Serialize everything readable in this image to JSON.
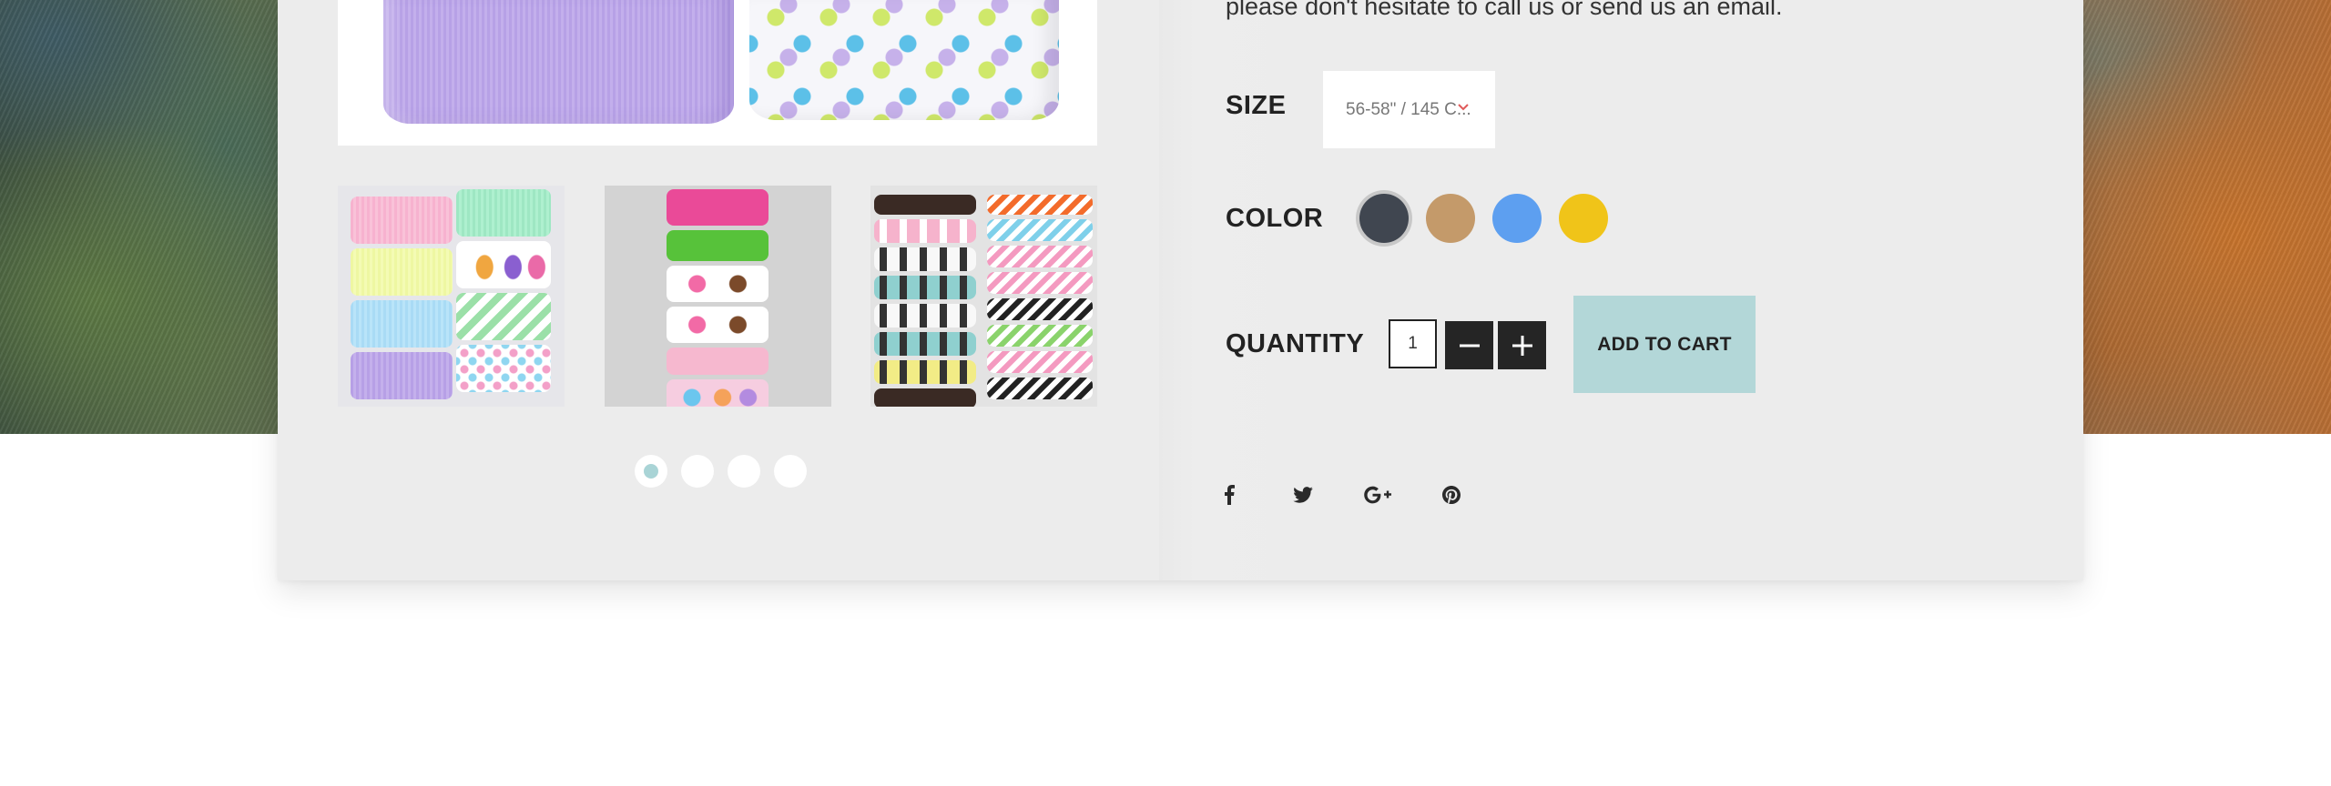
{
  "product": {
    "description_tail": "please don't hesitate to call us or send us an email."
  },
  "size": {
    "label": "SIZE",
    "selected": "56-58\" / 145 C...",
    "chevron_icon": "chevron-down-icon"
  },
  "color": {
    "label": "COLOR",
    "swatches": [
      {
        "name": "charcoal",
        "hex": "#404650",
        "selected": true
      },
      {
        "name": "tan",
        "hex": "#c49a6a",
        "selected": false
      },
      {
        "name": "blue",
        "hex": "#5d9ff0",
        "selected": false
      },
      {
        "name": "yellow",
        "hex": "#f0c419",
        "selected": false
      }
    ]
  },
  "quantity": {
    "label": "QUANTITY",
    "value": "1",
    "minus_icon": "minus-icon",
    "plus_icon": "plus-icon"
  },
  "cart": {
    "add_label": "ADD TO CART",
    "button_color": "#b3d7d8"
  },
  "gallery": {
    "thumbnails": [
      "ribbon-set-pastel",
      "ribbon-set-cupcake",
      "ribbon-set-pattern"
    ],
    "dots_count": 4,
    "active_dot": 0,
    "dot_active_color": "#a9d4d6"
  },
  "social": [
    {
      "icon": "facebook-icon"
    },
    {
      "icon": "twitter-icon"
    },
    {
      "icon": "google-plus-icon"
    },
    {
      "icon": "pinterest-icon"
    }
  ]
}
